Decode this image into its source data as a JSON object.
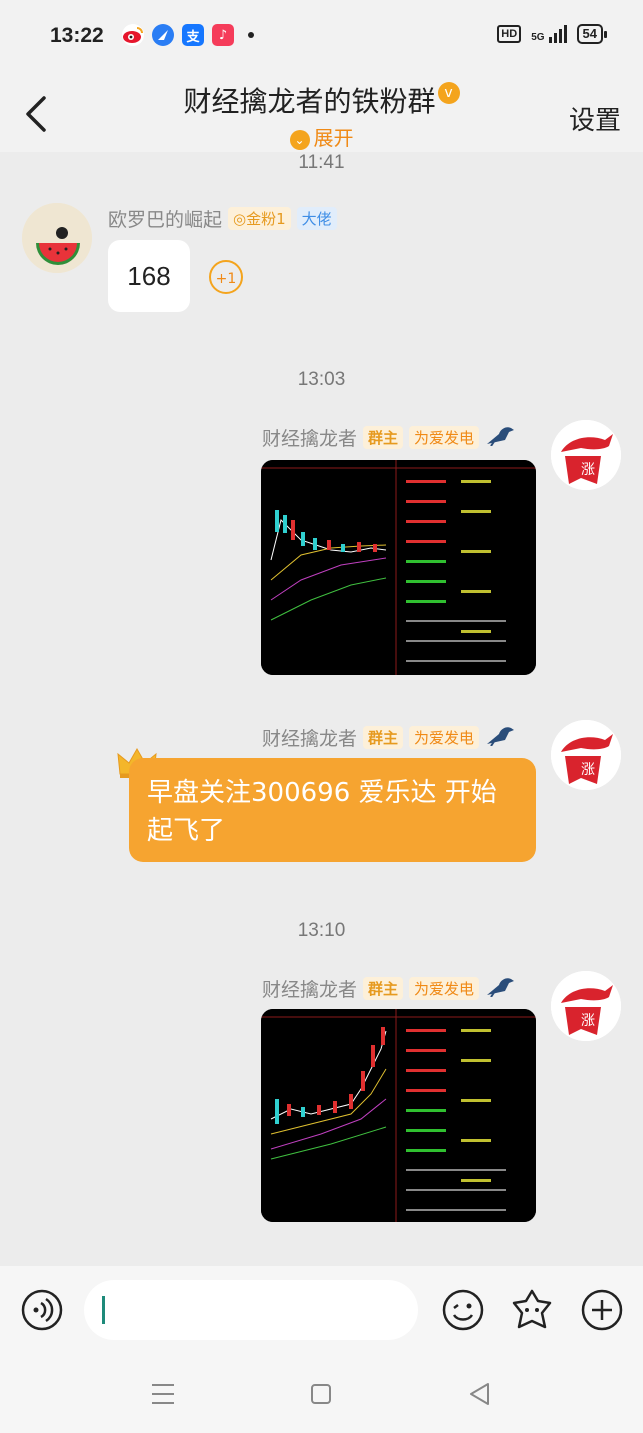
{
  "status_bar": {
    "time": "13:22",
    "network": "5G",
    "hd_label": "HD",
    "battery": "54"
  },
  "header": {
    "title": "财经擒龙者的铁粉群",
    "expand_label": "展开",
    "settings_label": "设置",
    "verified_badge": "v"
  },
  "messages": [
    {
      "type": "timestamp",
      "text": "11:41"
    },
    {
      "type": "text",
      "side": "left",
      "sender": "欧罗巴的崛起",
      "tags": [
        "金粉1",
        "大佬"
      ],
      "text": "168",
      "reaction": "+1"
    },
    {
      "type": "timestamp",
      "text": "13:03"
    },
    {
      "type": "image",
      "side": "right",
      "sender": "财经擒龙者",
      "tags": [
        "群主",
        "为爱发电"
      ],
      "image_desc": "stock-chart-300696"
    },
    {
      "type": "text",
      "side": "right",
      "sender": "财经擒龙者",
      "tags": [
        "群主",
        "为爱发电"
      ],
      "text": "早盘关注300696 爱乐达  开始起飞了"
    },
    {
      "type": "timestamp",
      "text": "13:10"
    },
    {
      "type": "image",
      "side": "right",
      "sender": "财经擒龙者",
      "tags": [
        "群主",
        "为爱发电"
      ],
      "image_desc": "stock-chart-second"
    }
  ],
  "avatar_badge": "涨",
  "input_bar": {
    "placeholder": ""
  },
  "colors": {
    "accent": "#f6a430",
    "tag_gold": "#e69a1f",
    "tag_blue": "#3f8ee6",
    "background": "#ececec"
  }
}
